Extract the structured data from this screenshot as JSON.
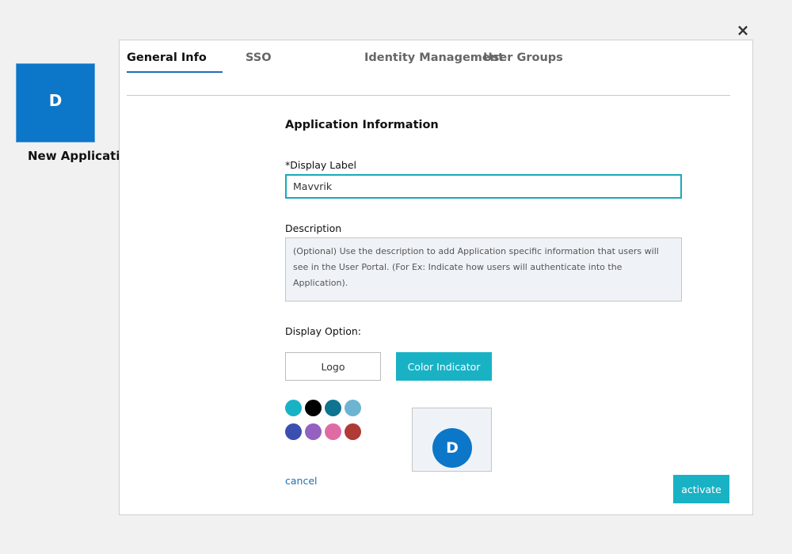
{
  "close_label": "×",
  "app_tile": {
    "initial": "D",
    "name": "New Application"
  },
  "tabs": [
    {
      "label": "General Info"
    },
    {
      "label": "SSO"
    },
    {
      "label": "Identity Management"
    },
    {
      "label": "User Groups"
    }
  ],
  "form": {
    "section_title": "Application Information",
    "display_label": {
      "label": "*Display Label",
      "value": "Mavvrik"
    },
    "description": {
      "label": "Description",
      "placeholder": "(Optional) Use the description to add Application specific information that users will see in the User Portal. (For Ex: Indicate how users will authenticate into the Application)."
    },
    "display_option": {
      "label": "Display Option:",
      "logo_label": "Logo",
      "color_label": "Color Indicator",
      "selected": "Color Indicator"
    },
    "swatches": [
      {
        "name": "cyan",
        "color": "#19b2c5"
      },
      {
        "name": "black",
        "color": "#000000"
      },
      {
        "name": "teal",
        "color": "#0e7490"
      },
      {
        "name": "light-blue",
        "color": "#6cb4d2"
      },
      {
        "name": "indigo",
        "color": "#3b4fb0"
      },
      {
        "name": "purple",
        "color": "#9461c2"
      },
      {
        "name": "pink",
        "color": "#df6ba4"
      },
      {
        "name": "red",
        "color": "#b03a36"
      }
    ],
    "preview": {
      "initial": "D",
      "color": "#0c76c9"
    }
  },
  "actions": {
    "cancel_label": "cancel",
    "activate_label": "activate"
  },
  "colors": {
    "accent": "#19b2c5",
    "tile": "#0c76c9",
    "tab_active": "#1e6fb5"
  }
}
